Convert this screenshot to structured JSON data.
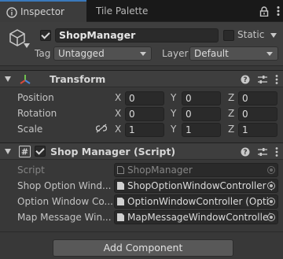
{
  "tabs": [
    {
      "label": "Inspector",
      "icon": "info-icon"
    },
    {
      "label": "Tile Palette"
    }
  ],
  "header": {
    "object_name": "ShopManager",
    "active": true,
    "static_label": "Static",
    "static_checked": false,
    "tag_label": "Tag",
    "tag_value": "Untagged",
    "layer_label": "Layer",
    "layer_value": "Default"
  },
  "transform": {
    "title": "Transform",
    "position_label": "Position",
    "rotation_label": "Rotation",
    "scale_label": "Scale",
    "axes": [
      "X",
      "Y",
      "Z"
    ],
    "position": [
      "0",
      "0",
      "0"
    ],
    "rotation": [
      "0",
      "0",
      "0"
    ],
    "scale": [
      "1",
      "1",
      "1"
    ]
  },
  "script_component": {
    "title": "Shop Manager (Script)",
    "enabled": true,
    "fields": [
      {
        "label": "Script",
        "value": "ShopManager"
      },
      {
        "label": "Shop Option Wind...",
        "value": "ShopOptionWindowController ("
      },
      {
        "label": "Option Window Co...",
        "value": "OptionWindowController (Optic"
      },
      {
        "label": "Map Message Win...",
        "value": "MapMessageWindowControllei"
      }
    ]
  },
  "add_component_label": "Add Component",
  "colors": {
    "tab_accent": "#3a79bb",
    "background": "#383838",
    "field_bg": "#2a2a2a",
    "button_bg": "#585858"
  }
}
